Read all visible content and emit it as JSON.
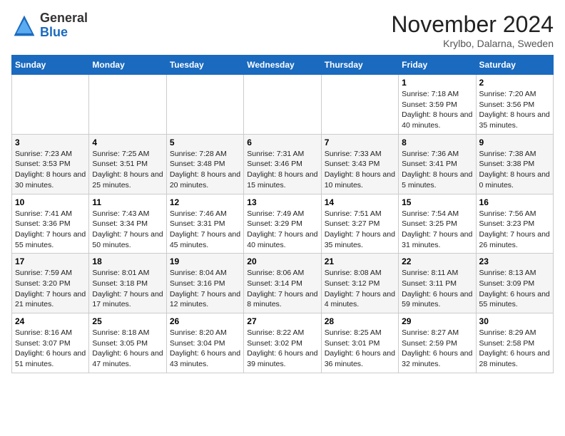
{
  "logo": {
    "general": "General",
    "blue": "Blue"
  },
  "header": {
    "title": "November 2024",
    "location": "Krylbo, Dalarna, Sweden"
  },
  "weekdays": [
    "Sunday",
    "Monday",
    "Tuesday",
    "Wednesday",
    "Thursday",
    "Friday",
    "Saturday"
  ],
  "weeks": [
    [
      {
        "day": "",
        "info": ""
      },
      {
        "day": "",
        "info": ""
      },
      {
        "day": "",
        "info": ""
      },
      {
        "day": "",
        "info": ""
      },
      {
        "day": "",
        "info": ""
      },
      {
        "day": "1",
        "info": "Sunrise: 7:18 AM\nSunset: 3:59 PM\nDaylight: 8 hours and 40 minutes."
      },
      {
        "day": "2",
        "info": "Sunrise: 7:20 AM\nSunset: 3:56 PM\nDaylight: 8 hours and 35 minutes."
      }
    ],
    [
      {
        "day": "3",
        "info": "Sunrise: 7:23 AM\nSunset: 3:53 PM\nDaylight: 8 hours and 30 minutes."
      },
      {
        "day": "4",
        "info": "Sunrise: 7:25 AM\nSunset: 3:51 PM\nDaylight: 8 hours and 25 minutes."
      },
      {
        "day": "5",
        "info": "Sunrise: 7:28 AM\nSunset: 3:48 PM\nDaylight: 8 hours and 20 minutes."
      },
      {
        "day": "6",
        "info": "Sunrise: 7:31 AM\nSunset: 3:46 PM\nDaylight: 8 hours and 15 minutes."
      },
      {
        "day": "7",
        "info": "Sunrise: 7:33 AM\nSunset: 3:43 PM\nDaylight: 8 hours and 10 minutes."
      },
      {
        "day": "8",
        "info": "Sunrise: 7:36 AM\nSunset: 3:41 PM\nDaylight: 8 hours and 5 minutes."
      },
      {
        "day": "9",
        "info": "Sunrise: 7:38 AM\nSunset: 3:38 PM\nDaylight: 8 hours and 0 minutes."
      }
    ],
    [
      {
        "day": "10",
        "info": "Sunrise: 7:41 AM\nSunset: 3:36 PM\nDaylight: 7 hours and 55 minutes."
      },
      {
        "day": "11",
        "info": "Sunrise: 7:43 AM\nSunset: 3:34 PM\nDaylight: 7 hours and 50 minutes."
      },
      {
        "day": "12",
        "info": "Sunrise: 7:46 AM\nSunset: 3:31 PM\nDaylight: 7 hours and 45 minutes."
      },
      {
        "day": "13",
        "info": "Sunrise: 7:49 AM\nSunset: 3:29 PM\nDaylight: 7 hours and 40 minutes."
      },
      {
        "day": "14",
        "info": "Sunrise: 7:51 AM\nSunset: 3:27 PM\nDaylight: 7 hours and 35 minutes."
      },
      {
        "day": "15",
        "info": "Sunrise: 7:54 AM\nSunset: 3:25 PM\nDaylight: 7 hours and 31 minutes."
      },
      {
        "day": "16",
        "info": "Sunrise: 7:56 AM\nSunset: 3:23 PM\nDaylight: 7 hours and 26 minutes."
      }
    ],
    [
      {
        "day": "17",
        "info": "Sunrise: 7:59 AM\nSunset: 3:20 PM\nDaylight: 7 hours and 21 minutes."
      },
      {
        "day": "18",
        "info": "Sunrise: 8:01 AM\nSunset: 3:18 PM\nDaylight: 7 hours and 17 minutes."
      },
      {
        "day": "19",
        "info": "Sunrise: 8:04 AM\nSunset: 3:16 PM\nDaylight: 7 hours and 12 minutes."
      },
      {
        "day": "20",
        "info": "Sunrise: 8:06 AM\nSunset: 3:14 PM\nDaylight: 7 hours and 8 minutes."
      },
      {
        "day": "21",
        "info": "Sunrise: 8:08 AM\nSunset: 3:12 PM\nDaylight: 7 hours and 4 minutes."
      },
      {
        "day": "22",
        "info": "Sunrise: 8:11 AM\nSunset: 3:11 PM\nDaylight: 6 hours and 59 minutes."
      },
      {
        "day": "23",
        "info": "Sunrise: 8:13 AM\nSunset: 3:09 PM\nDaylight: 6 hours and 55 minutes."
      }
    ],
    [
      {
        "day": "24",
        "info": "Sunrise: 8:16 AM\nSunset: 3:07 PM\nDaylight: 6 hours and 51 minutes."
      },
      {
        "day": "25",
        "info": "Sunrise: 8:18 AM\nSunset: 3:05 PM\nDaylight: 6 hours and 47 minutes."
      },
      {
        "day": "26",
        "info": "Sunrise: 8:20 AM\nSunset: 3:04 PM\nDaylight: 6 hours and 43 minutes."
      },
      {
        "day": "27",
        "info": "Sunrise: 8:22 AM\nSunset: 3:02 PM\nDaylight: 6 hours and 39 minutes."
      },
      {
        "day": "28",
        "info": "Sunrise: 8:25 AM\nSunset: 3:01 PM\nDaylight: 6 hours and 36 minutes."
      },
      {
        "day": "29",
        "info": "Sunrise: 8:27 AM\nSunset: 2:59 PM\nDaylight: 6 hours and 32 minutes."
      },
      {
        "day": "30",
        "info": "Sunrise: 8:29 AM\nSunset: 2:58 PM\nDaylight: 6 hours and 28 minutes."
      }
    ]
  ]
}
